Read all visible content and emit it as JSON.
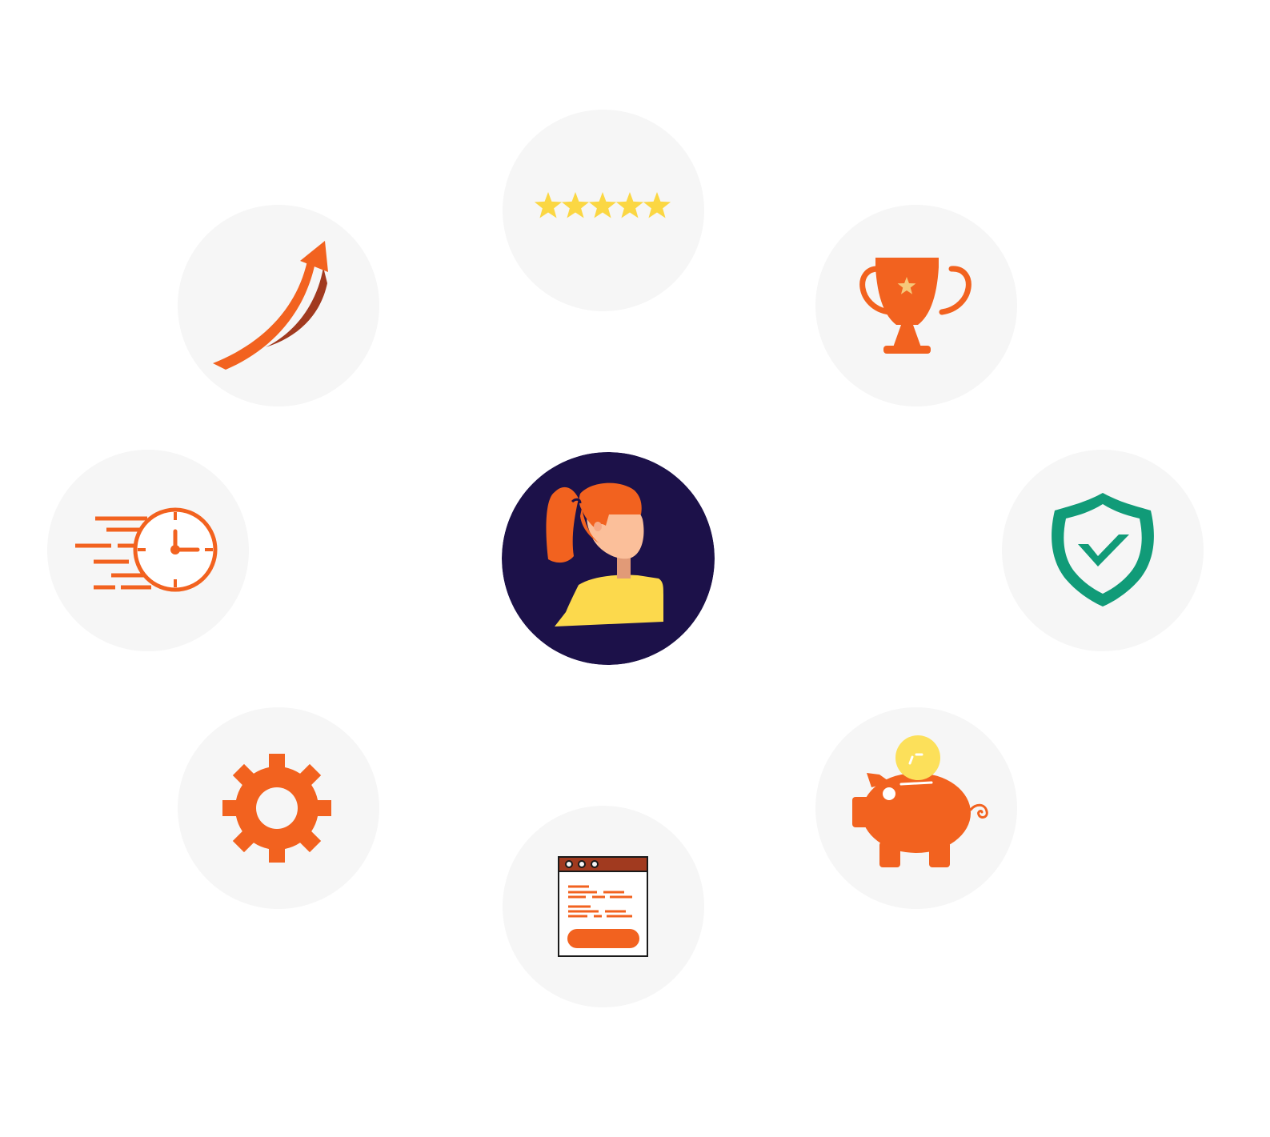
{
  "colors": {
    "bubble_background": "#f6f6f6",
    "primary_orange": "#f2621f",
    "dark_orange": "#a13a1f",
    "star_yellow": "#fbd743",
    "trophy_star": "#f6c87a",
    "shield_green": "#119b78",
    "center_navy": "#1c1149",
    "shirt_yellow": "#fcd94c",
    "skin": "#fbbf9a",
    "neck": "#e19a77",
    "coin_yellow": "#fce05a"
  },
  "rating": {
    "stars_filled": 5,
    "stars_total": 5
  },
  "icons": [
    "five-star-rating-icon",
    "growth-arrow-icon",
    "trophy-icon",
    "fast-clock-icon",
    "shield-check-icon",
    "gear-icon",
    "piggy-bank-icon",
    "web-form-icon",
    "woman-avatar-icon"
  ]
}
